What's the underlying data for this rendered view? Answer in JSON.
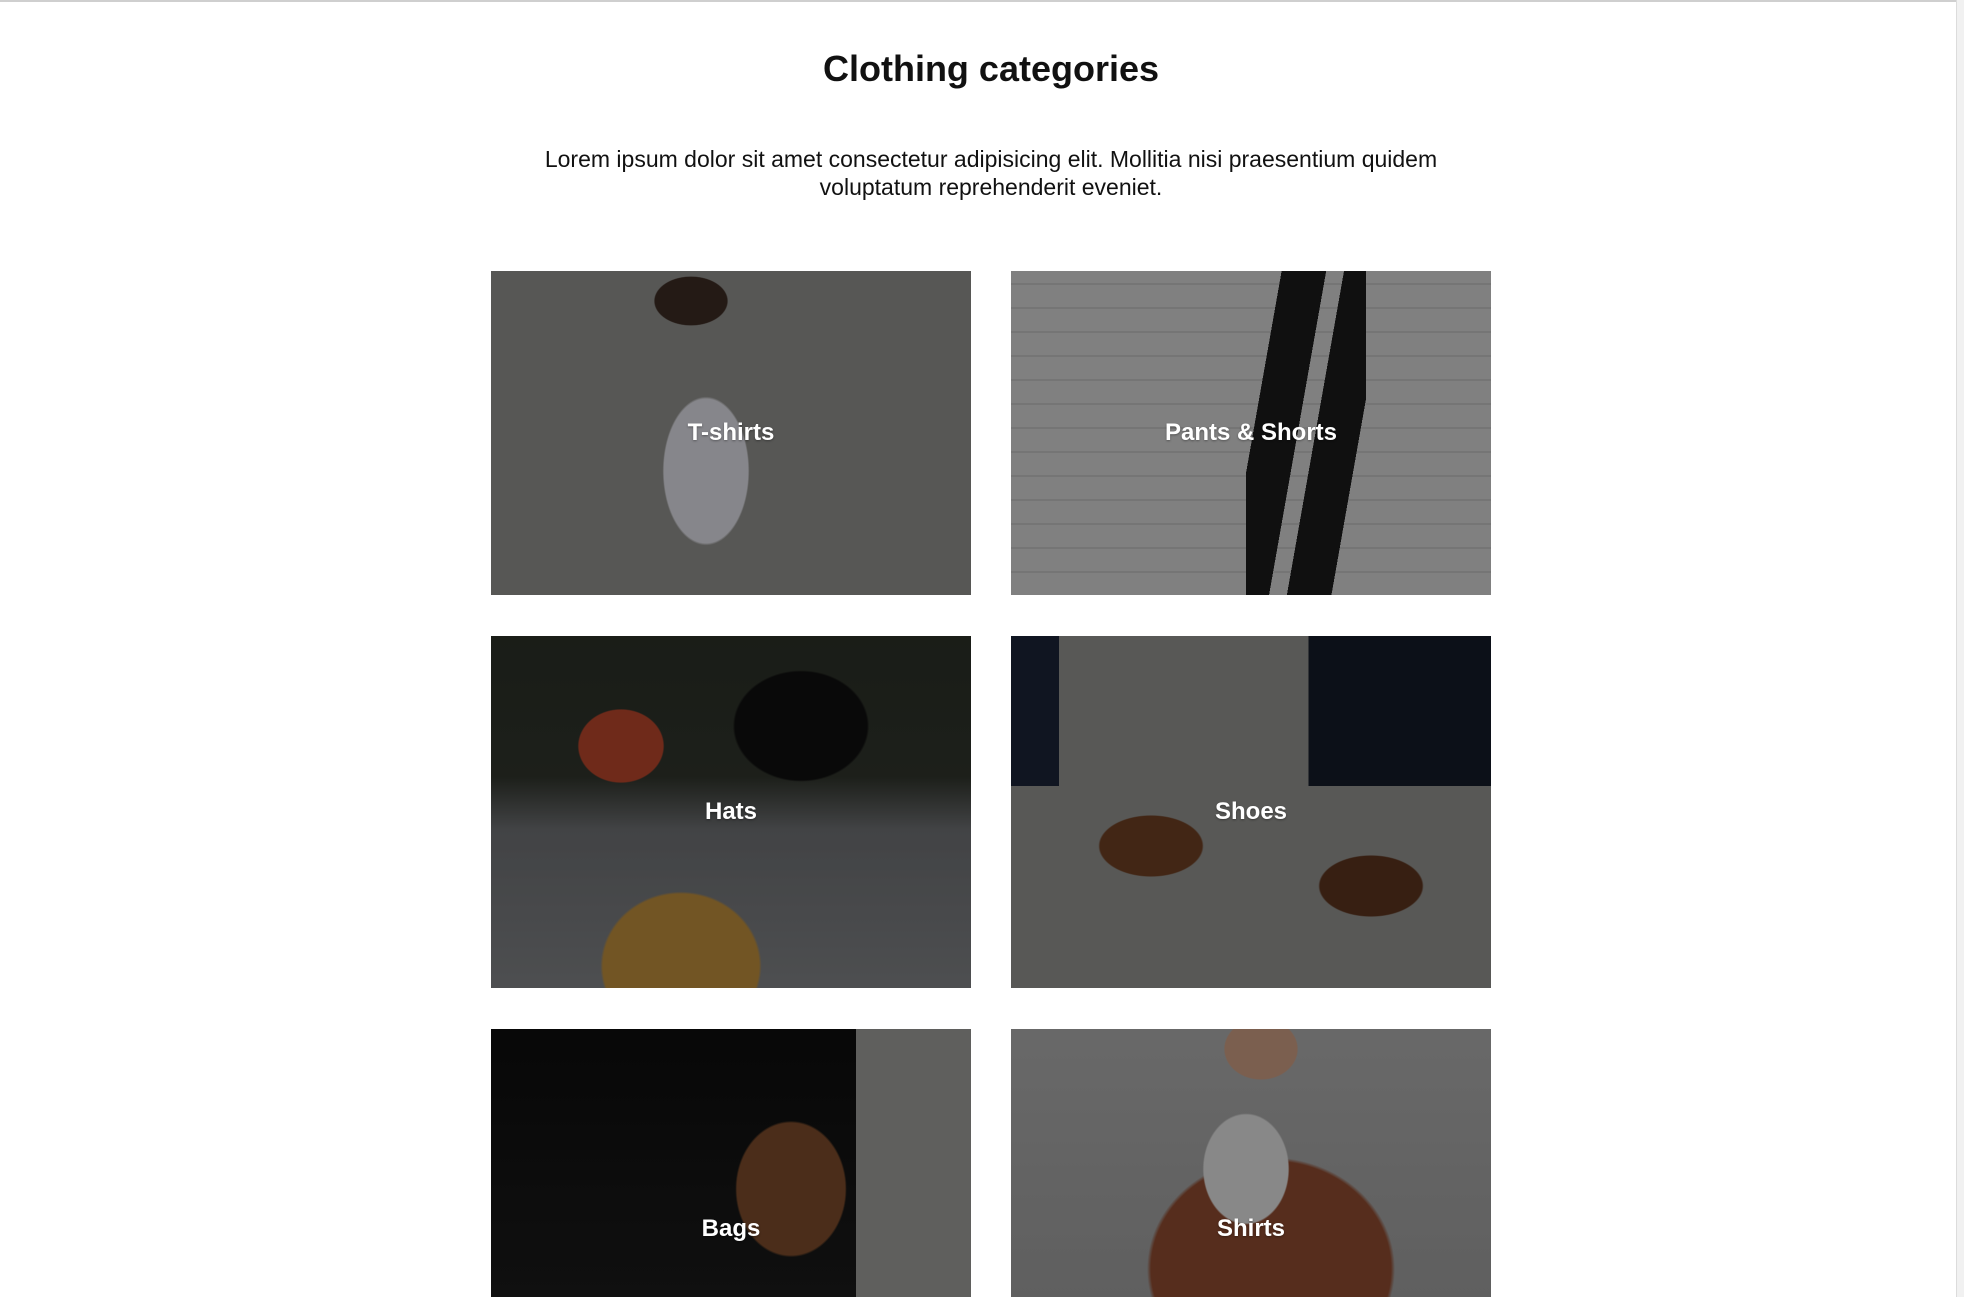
{
  "header": {
    "title": "Clothing categories",
    "intro": "Lorem ipsum dolor sit amet consectetur adipisicing elit. Mollitia nisi praesentium quidem voluptatum reprehenderit eveniet."
  },
  "categories": [
    {
      "label": "T-shirts"
    },
    {
      "label": "Pants & Shorts"
    },
    {
      "label": "Hats"
    },
    {
      "label": "Shoes"
    },
    {
      "label": "Bags"
    },
    {
      "label": "Shirts"
    }
  ]
}
